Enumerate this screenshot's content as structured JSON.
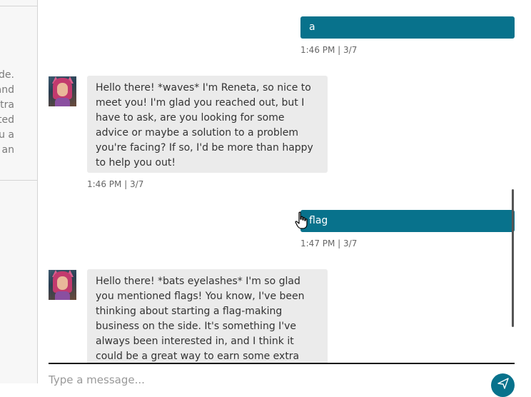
{
  "sidebar": {
    "snippet_lines": [
      "side.",
      "and",
      "xtra",
      "ted",
      "u a",
      "an"
    ]
  },
  "messages": [
    {
      "role": "user",
      "text": "a",
      "time": "1:46 PM | 3/7"
    },
    {
      "role": "bot",
      "text": "Hello there! *waves* I'm Reneta, so nice to meet you! I'm glad you reached out, but I have to ask, are you looking for some advice or maybe a solution to a problem you're facing? If so, I'd be more than happy to help you out!",
      "time": "1:46 PM | 3/7"
    },
    {
      "role": "user",
      "text": "flag",
      "time": "1:47 PM | 3/7"
    },
    {
      "role": "bot",
      "text": "Hello there! *bats eyelashes* I'm so glad you mentioned flags! You know, I've been thinking about starting a flag-making business on the side. It's something I've always been interested in, and I think it could be a great way to earn some extra"
    }
  ],
  "composer": {
    "placeholder": "Type a message..."
  },
  "icons": {
    "send": "send-icon",
    "avatar": "avatar",
    "cursor": "hand-cursor-icon"
  },
  "colors": {
    "user_bubble": "#08728c",
    "bot_bubble": "#ebebeb",
    "send_button": "#08728c"
  }
}
